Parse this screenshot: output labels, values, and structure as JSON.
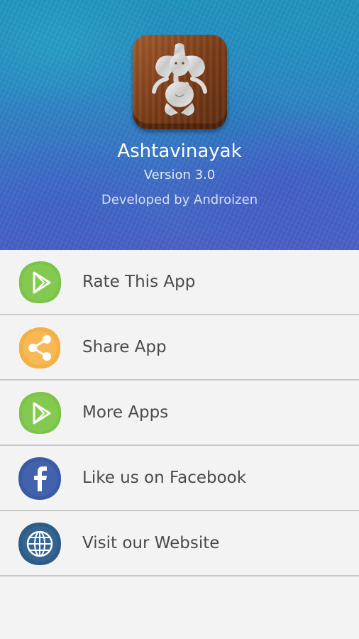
{
  "app": {
    "name": "Ashtavinayak",
    "version": "Version 3.0",
    "developer": "Developed by Androizen",
    "icon": "ganesha-icon"
  },
  "menu": {
    "items": [
      {
        "label": "Rate This App",
        "icon": "play-store-icon",
        "color": "#7cc34a"
      },
      {
        "label": "Share App",
        "icon": "share-icon",
        "color": "#f4b042"
      },
      {
        "label": "More Apps",
        "icon": "play-store-icon",
        "color": "#7cc34a"
      },
      {
        "label": "Like us on Facebook",
        "icon": "facebook-icon",
        "color": "#3b5aa6"
      },
      {
        "label": "Visit our Website",
        "icon": "globe-icon",
        "color": "#2e5c86"
      }
    ]
  }
}
